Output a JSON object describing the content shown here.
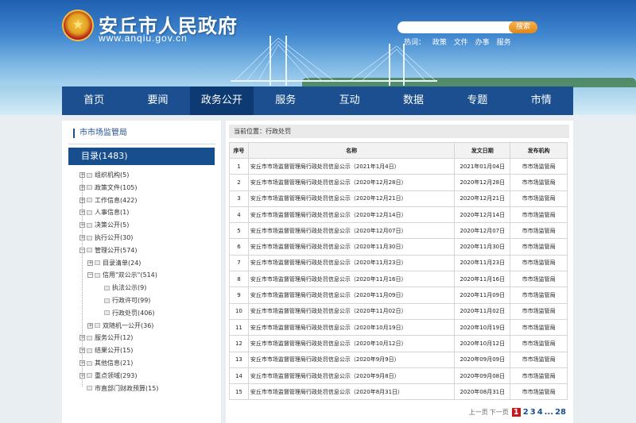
{
  "header": {
    "title": "安丘市人民政府",
    "url": "www.anqiu.gov.cn",
    "search_button": "搜索",
    "hotwords_label": "热词：",
    "hotwords": [
      "政策",
      "文件",
      "办事",
      "服务"
    ]
  },
  "nav": {
    "items": [
      "首页",
      "要闻",
      "政务公开",
      "服务",
      "互动",
      "数据",
      "专题",
      "市情"
    ],
    "active_index": 2
  },
  "sidebar": {
    "title": "市市场监管局",
    "catalog": "目录(1483)",
    "tree": [
      {
        "label": "组织机构(5)",
        "level": 0,
        "expander": "+"
      },
      {
        "label": "政策文件(105)",
        "level": 0,
        "expander": "+"
      },
      {
        "label": "工作信息(422)",
        "level": 0,
        "expander": "+"
      },
      {
        "label": "人事信息(1)",
        "level": 0,
        "expander": "+"
      },
      {
        "label": "决策公开(5)",
        "level": 0,
        "expander": "+"
      },
      {
        "label": "执行公开(30)",
        "level": 0,
        "expander": "+"
      },
      {
        "label": "管理公开(574)",
        "level": 0,
        "expander": "−"
      },
      {
        "label": "目录清单(24)",
        "level": 1,
        "expander": "+"
      },
      {
        "label": "信用\"双公示\"(514)",
        "level": 1,
        "expander": "−"
      },
      {
        "label": "执法公示(9)",
        "level": 2,
        "expander": ""
      },
      {
        "label": "行政许可(99)",
        "level": 2,
        "expander": ""
      },
      {
        "label": "行政处罚(406)",
        "level": 2,
        "expander": ""
      },
      {
        "label": "双随机一公开(36)",
        "level": 1,
        "expander": "+"
      },
      {
        "label": "服务公开(12)",
        "level": 0,
        "expander": "+"
      },
      {
        "label": "结果公开(15)",
        "level": 0,
        "expander": "+"
      },
      {
        "label": "其他信息(21)",
        "level": 0,
        "expander": "+"
      },
      {
        "label": "重点领域(293)",
        "level": 0,
        "expander": "+"
      },
      {
        "label": "市直部门财政预算(15)",
        "level": 0,
        "expander": ""
      }
    ]
  },
  "main": {
    "breadcrumb": "当前位置：行政处罚",
    "table": {
      "headers": [
        "序号",
        "名称",
        "发文日期",
        "发布机构"
      ],
      "rows": [
        [
          "1",
          "安丘市市场监督管理局行政处罚信息公示（2021年1月4日）",
          "2021年01月04日",
          "市市场监管局"
        ],
        [
          "2",
          "安丘市市场监督管理局行政处罚信息公示（2020年12月28日）",
          "2020年12月28日",
          "市市场监管局"
        ],
        [
          "3",
          "安丘市市场监督管理局行政处罚信息公示（2020年12月21日）",
          "2020年12月21日",
          "市市场监管局"
        ],
        [
          "4",
          "安丘市市场监督管理局行政处罚信息公示（2020年12月14日）",
          "2020年12月14日",
          "市市场监管局"
        ],
        [
          "5",
          "安丘市市场监督管理局行政处罚信息公示（2020年12月07日）",
          "2020年12月07日",
          "市市场监管局"
        ],
        [
          "6",
          "安丘市市场监督管理局行政处罚信息公示（2020年11月30日）",
          "2020年11月30日",
          "市市场监管局"
        ],
        [
          "7",
          "安丘市市场监督管理局行政处罚信息公示（2020年11月23日）",
          "2020年11月23日",
          "市市场监管局"
        ],
        [
          "8",
          "安丘市市场监督管理局行政处罚信息公示（2020年11月16日）",
          "2020年11月16日",
          "市市场监管局"
        ],
        [
          "9",
          "安丘市市场监督管理局行政处罚信息公示（2020年11月09日）",
          "2020年11月09日",
          "市市场监管局"
        ],
        [
          "10",
          "安丘市市场监督管理局行政处罚信息公示（2020年11月02日）",
          "2020年11月02日",
          "市市场监管局"
        ],
        [
          "11",
          "安丘市市场监督管理局行政处罚信息公示（2020年10月19日）",
          "2020年10月19日",
          "市市场监管局"
        ],
        [
          "12",
          "安丘市市场监督管理局行政处罚信息公示（2020年10月12日）",
          "2020年10月12日",
          "市市场监管局"
        ],
        [
          "13",
          "安丘市市场监督管理局行政处罚信息公示（2020年9月9日）",
          "2020年09月09日",
          "市市场监管局"
        ],
        [
          "14",
          "安丘市市场监督管理局行政处罚信息公示（2020年9月8日）",
          "2020年09月08日",
          "市市场监管局"
        ],
        [
          "15",
          "安丘市市场监督管理局行政处罚信息公示（2020年8月31日）",
          "2020年08月31日",
          "市市场监管局"
        ]
      ]
    },
    "pager": {
      "prev": "上一页",
      "next": "下一页",
      "current": "1",
      "pages": [
        "2",
        "3",
        "4"
      ],
      "ellipsis": "...",
      "last": "28"
    }
  }
}
